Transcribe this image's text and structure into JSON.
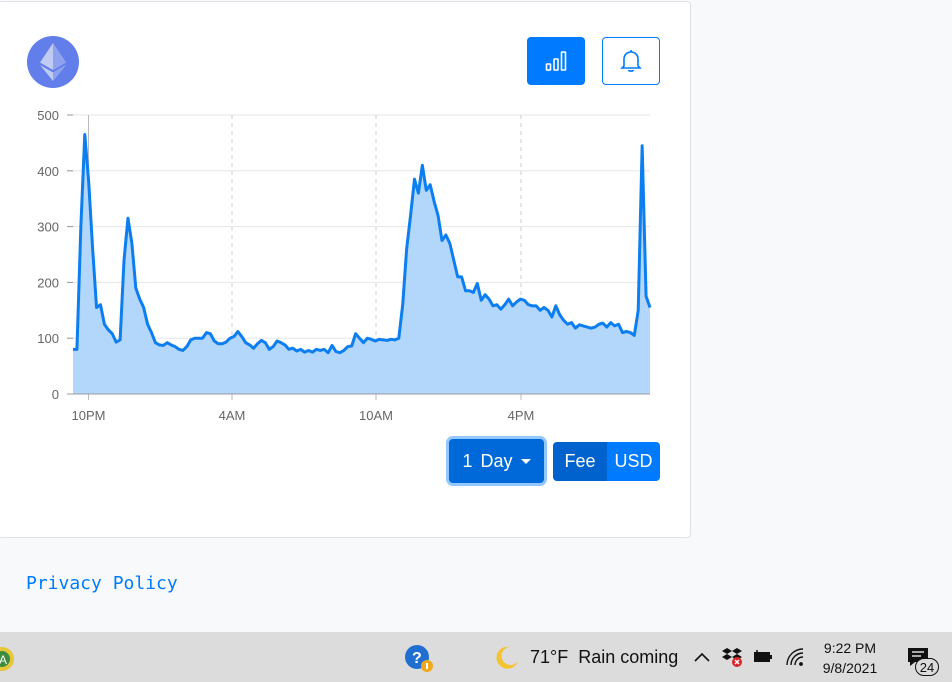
{
  "card": {
    "logo_icon": "ethereum-logo",
    "chart_button_icon": "bar-chart-icon",
    "bell_button_icon": "bell-icon"
  },
  "controls": {
    "range_value": "1",
    "range_unit": "Day",
    "fee_label": "Fee",
    "usd_label": "USD"
  },
  "footer": {
    "privacy_label": "Privacy Policy"
  },
  "taskbar": {
    "weather_temp": "71°F",
    "weather_text": "Rain coming",
    "time": "9:22 PM",
    "date": "9/8/2021",
    "notification_count": "24",
    "icons": [
      "app-icon",
      "help-icon",
      "moon-icon",
      "chevron-up-icon",
      "dropbox-icon",
      "battery-icon",
      "wifi-icon",
      "notification-icon"
    ]
  },
  "colors": {
    "primary": "#007bff",
    "line": "#0d7ef0",
    "area": "#b3d7fb"
  },
  "chart_data": {
    "type": "area",
    "x_ticks": [
      "10PM",
      "4AM",
      "10AM",
      "4PM"
    ],
    "y_ticks": [
      "0",
      "100",
      "200",
      "300",
      "400",
      "500"
    ],
    "ylim": [
      0,
      500
    ],
    "grid": true,
    "values": [
      80,
      80,
      300,
      465,
      380,
      260,
      155,
      160,
      125,
      115,
      108,
      93,
      97,
      240,
      315,
      270,
      190,
      170,
      155,
      125,
      110,
      92,
      88,
      87,
      92,
      88,
      85,
      80,
      78,
      85,
      97,
      100,
      100,
      100,
      110,
      108,
      95,
      90,
      90,
      93,
      100,
      103,
      112,
      103,
      92,
      88,
      82,
      90,
      96,
      92,
      80,
      85,
      95,
      92,
      88,
      80,
      82,
      77,
      80,
      75,
      78,
      75,
      80,
      78,
      80,
      74,
      87,
      76,
      74,
      78,
      85,
      86,
      108,
      100,
      92,
      100,
      98,
      95,
      98,
      97,
      96,
      98,
      97,
      100,
      160,
      260,
      320,
      385,
      360,
      410,
      365,
      375,
      345,
      320,
      275,
      285,
      270,
      240,
      210,
      210,
      185,
      185,
      182,
      198,
      168,
      178,
      170,
      158,
      160,
      152,
      160,
      170,
      158,
      165,
      170,
      168,
      160,
      158,
      158,
      150,
      155,
      150,
      138,
      158,
      142,
      132,
      125,
      128,
      118,
      124,
      122,
      120,
      118,
      120,
      125,
      127,
      120,
      128,
      122,
      125,
      110,
      112,
      110,
      105,
      150,
      445,
      175,
      155
    ]
  }
}
